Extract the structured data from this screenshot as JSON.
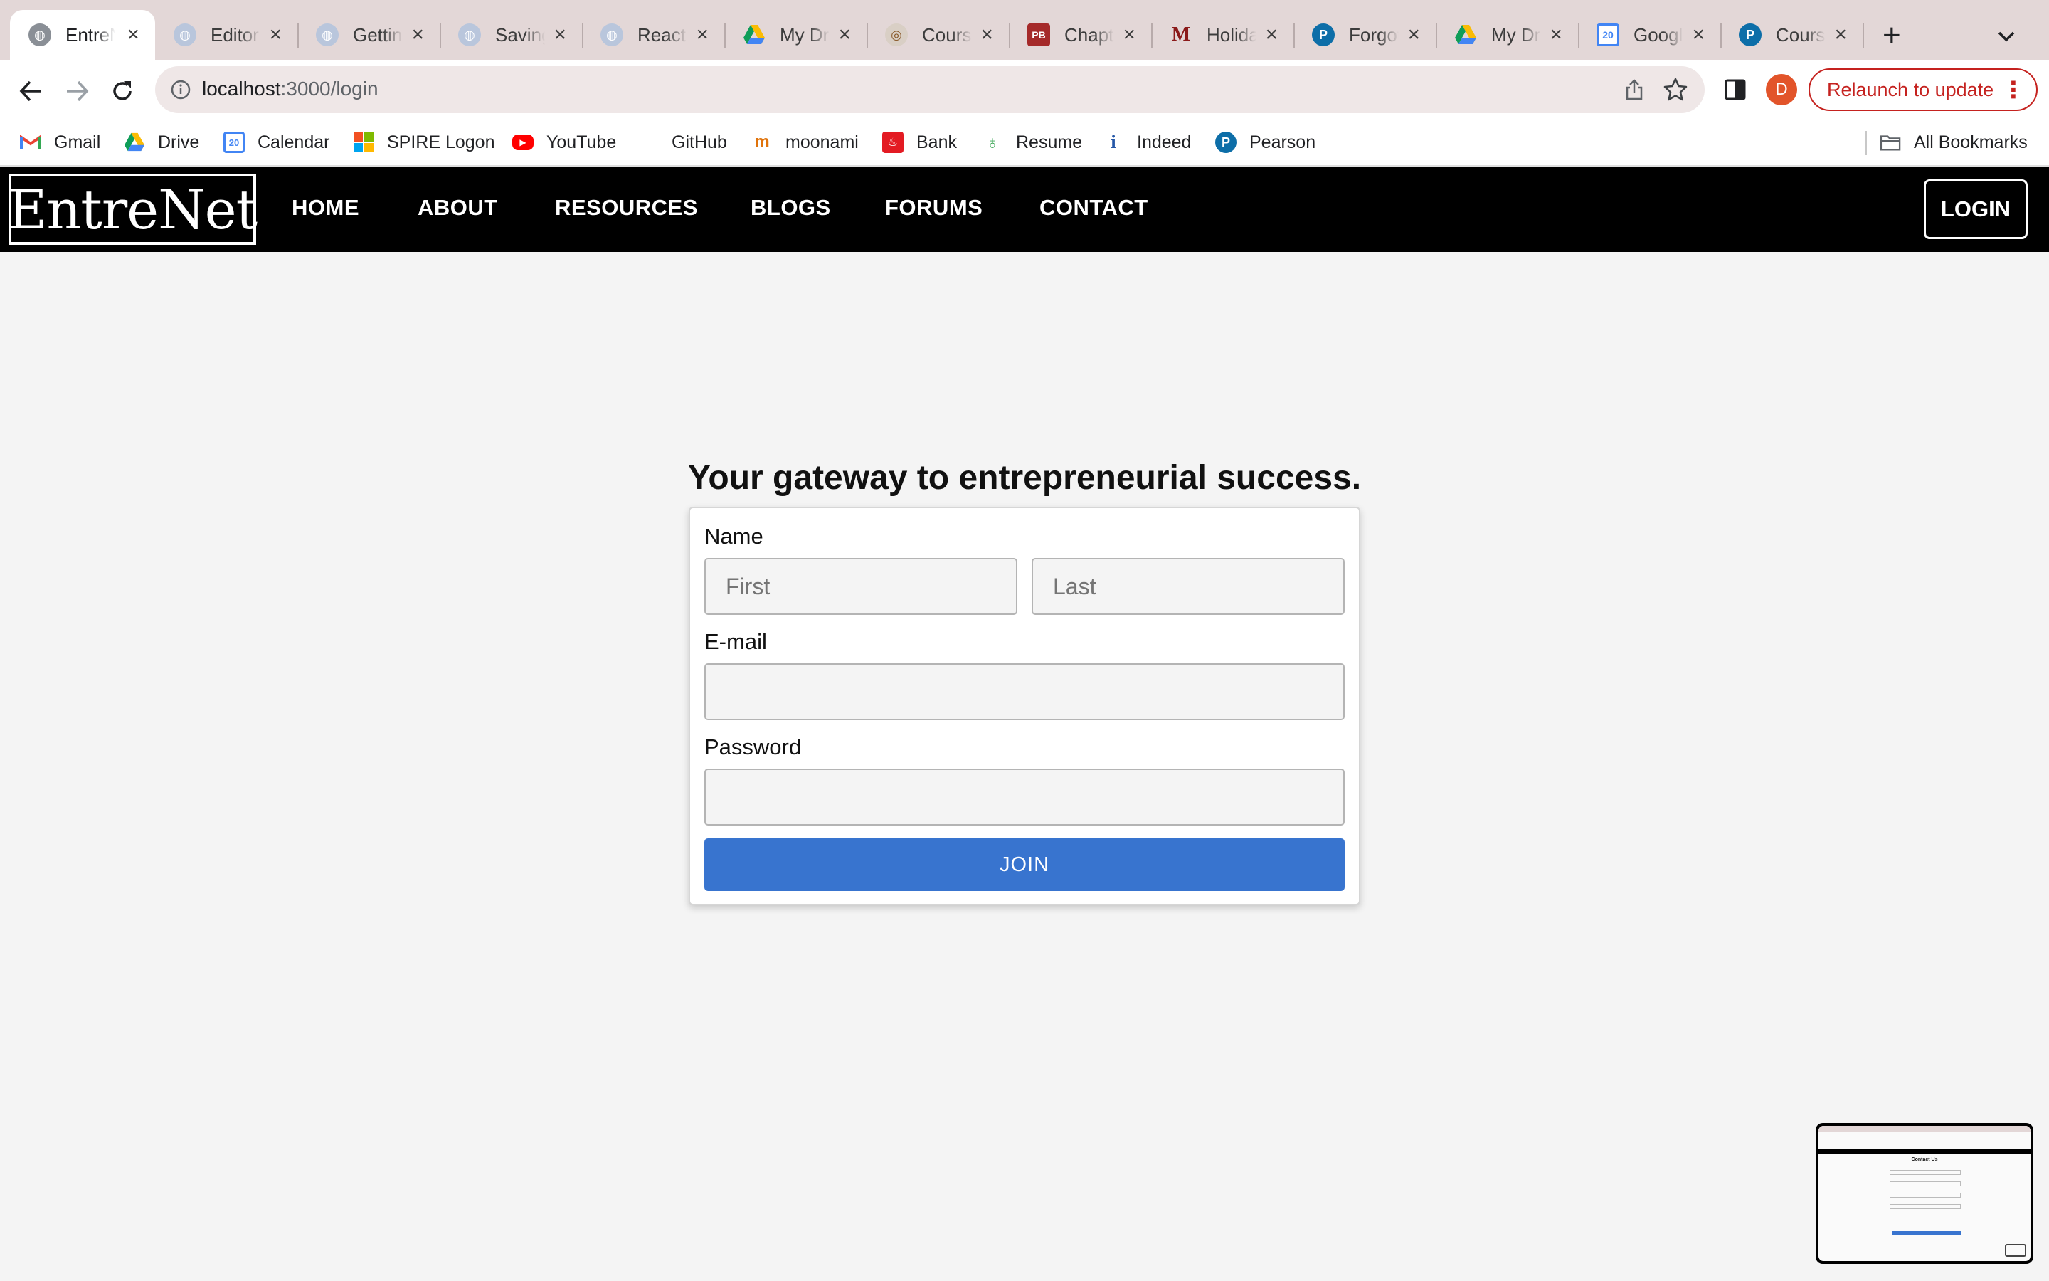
{
  "browser": {
    "tabs": [
      {
        "label": "EntreNet",
        "icon": "globe-icon",
        "active": true
      },
      {
        "label": "Editor",
        "icon": "globe-icon"
      },
      {
        "label": "Getting",
        "icon": "globe-icon"
      },
      {
        "label": "Saving",
        "icon": "globe-icon"
      },
      {
        "label": "React",
        "icon": "globe-icon"
      },
      {
        "label": "My Drive",
        "icon": "google-drive-icon"
      },
      {
        "label": "Course",
        "icon": "course-icon"
      },
      {
        "label": "Chapter",
        "icon": "pb-icon"
      },
      {
        "label": "Holiday",
        "icon": "umass-m-icon"
      },
      {
        "label": "Forgot",
        "icon": "pearson-icon"
      },
      {
        "label": "My Drive",
        "icon": "google-drive-icon"
      },
      {
        "label": "Google",
        "icon": "google-calendar-icon"
      },
      {
        "label": "Course",
        "icon": "pearson-icon"
      }
    ],
    "url": {
      "host": "localhost",
      "path": ":3000/login"
    },
    "profile_initial": "D",
    "relaunch_label": "Relaunch to update",
    "bookmarks": [
      {
        "label": "Gmail",
        "icon": "gmail-icon"
      },
      {
        "label": "Drive",
        "icon": "google-drive-icon"
      },
      {
        "label": "Calendar",
        "icon": "google-calendar-icon"
      },
      {
        "label": "SPIRE Logon",
        "icon": "microsoft-icon"
      },
      {
        "label": "YouTube",
        "icon": "youtube-icon"
      },
      {
        "label": "GitHub",
        "icon": "github-icon"
      },
      {
        "label": "moonami",
        "icon": "moonami-icon"
      },
      {
        "label": "Bank",
        "icon": "bank-icon"
      },
      {
        "label": "Resume",
        "icon": "resume-icon"
      },
      {
        "label": "Indeed",
        "icon": "indeed-icon"
      },
      {
        "label": "Pearson",
        "icon": "pearson-icon"
      }
    ],
    "all_bookmarks_label": "All Bookmarks"
  },
  "site": {
    "logo": "EntreNet",
    "nav": [
      "HOME",
      "ABOUT",
      "RESOURCES",
      "BLOGS",
      "FORUMS",
      "CONTACT"
    ],
    "login_label": "LOGIN"
  },
  "form": {
    "heading": "Your gateway to entrepreneurial success.",
    "name_label": "Name",
    "first_placeholder": "First",
    "last_placeholder": "Last",
    "email_label": "E-mail",
    "email_value": "",
    "password_label": "Password",
    "password_value": "",
    "submit_label": "JOIN"
  },
  "thumbnail": {
    "heading": "Contact Us"
  },
  "colors": {
    "navbar": "#000000",
    "accent_button": "#3874cf",
    "tabstrip": "#e3d7d7",
    "relaunch": "#c5221f",
    "avatar": "#e2542a"
  }
}
